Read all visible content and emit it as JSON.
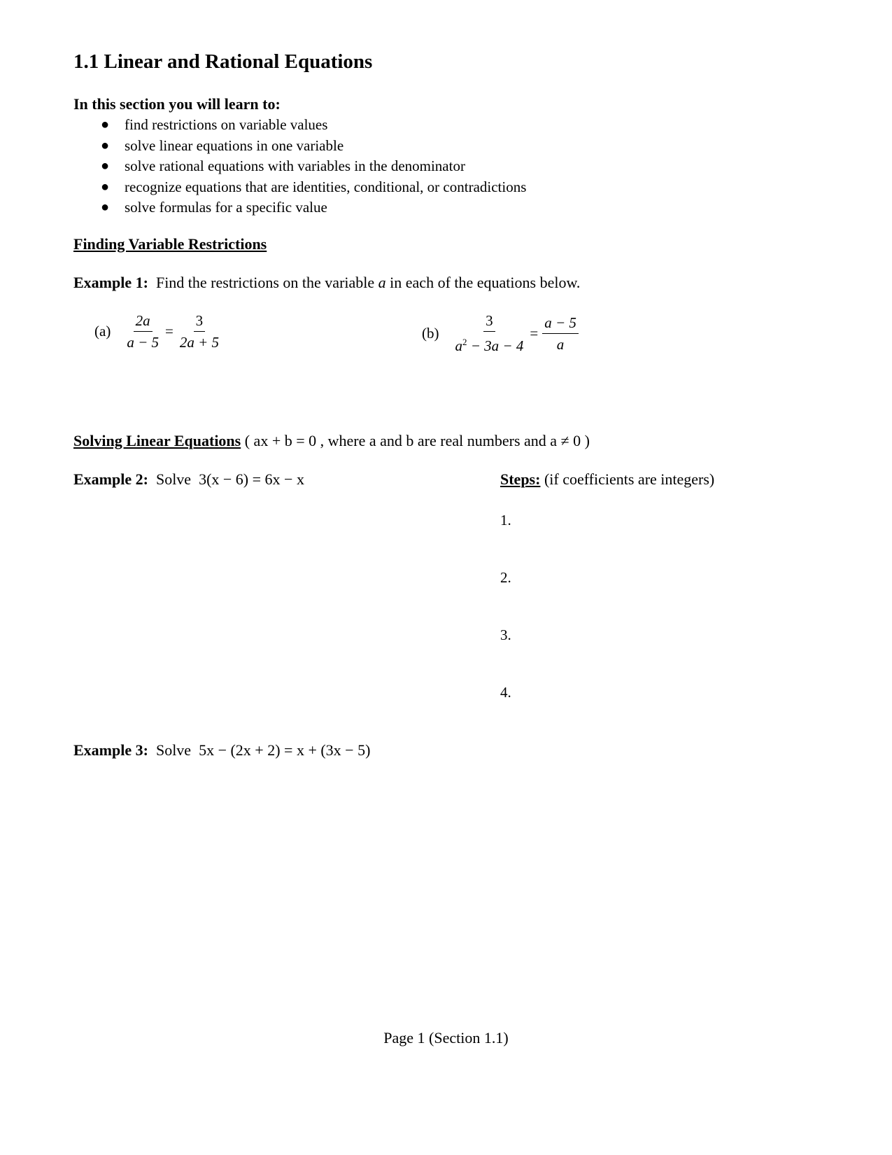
{
  "page": {
    "title": "1.1  Linear and Rational Equations",
    "learn_heading": "In this section you will learn to:",
    "objectives": [
      "find restrictions on variable values",
      "solve linear equations in one variable",
      "solve rational equations with variables in the denominator",
      "recognize equations that are identities, conditional, or contradictions",
      "solve formulas for a specific value"
    ],
    "section1": {
      "heading": "Finding Variable Restrictions",
      "example1": {
        "label": "Example 1:",
        "text_before": "Find the restrictions on the variable",
        "variable": "a",
        "text_after": "in each of the equations below.",
        "part_a": {
          "label": "(a)",
          "lhs_num": "2a",
          "lhs_den": "a − 5",
          "rhs_num": "3",
          "rhs_den": "2a + 5"
        },
        "part_b": {
          "label": "(b)",
          "lhs_num": "3",
          "lhs_den_base": "a",
          "lhs_den_exp": "2",
          "lhs_den_rest": " − 3a − 4",
          "rhs_num": "a − 5",
          "rhs_den": "a"
        }
      }
    },
    "section2": {
      "heading": "Solving Linear Equations",
      "form": "( ax + b = 0 , where a and b are real numbers and  a ≠ 0 )",
      "example2": {
        "label": "Example 2:",
        "verb": "Solve",
        "equation": "3(x − 6) = 6x − x"
      },
      "steps": {
        "label": "Steps:",
        "note": "(if coefficients are integers)",
        "numbers": [
          "1.",
          "2.",
          "3.",
          "4."
        ]
      },
      "example3": {
        "label": "Example 3:",
        "verb": "Solve",
        "equation": "5x − (2x + 2) = x + (3x − 5)"
      }
    },
    "equals": "=",
    "bullet_glyph": "●",
    "footer": "Page 1 (Section 1.1)"
  }
}
